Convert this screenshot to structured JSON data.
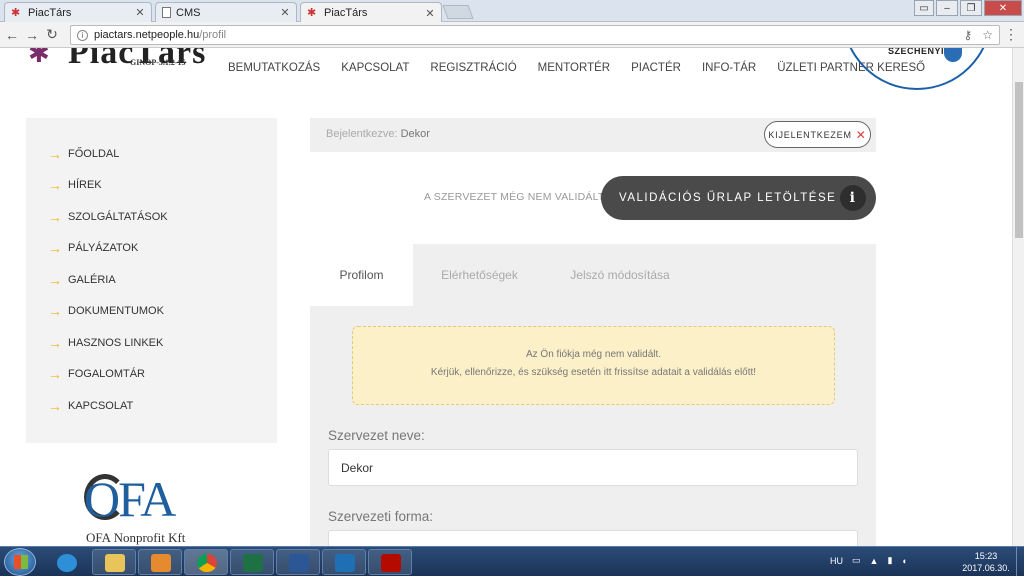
{
  "browser": {
    "tabs": [
      {
        "title": "PiacTárs",
        "icon": "piactars-favicon"
      },
      {
        "title": "CMS",
        "icon": "document-icon"
      },
      {
        "title": "PiacTárs",
        "icon": "piactars-favicon",
        "active": true
      }
    ],
    "url_domain": "piactars.netpeople.hu",
    "url_path": "/profil"
  },
  "site": {
    "logo_text": "PiacTárs",
    "logo_sub": "GINOP-5.1.2-15",
    "nav": [
      "BEMUTATKOZÁS",
      "KAPCSOLAT",
      "REGISZTRÁCIÓ",
      "MENTORTÉR",
      "PIACTÉR",
      "INFO-TÁR",
      "ÜZLETI PARTNER KERESŐ"
    ],
    "szechenyi_text": "SZÉCHENYI"
  },
  "sidebar": {
    "items": [
      "FŐOLDAL",
      "HÍREK",
      "SZOLGÁLTATÁSOK",
      "PÁLYÁZATOK",
      "GALÉRIA",
      "DOKUMENTUMOK",
      "HASZNOS LINKEK",
      "FOGALOMTÁR",
      "KAPCSOLAT"
    ],
    "ofa_logo": "OFA",
    "ofa_sub": "OFA Nonprofit Kft"
  },
  "account": {
    "logged_in_label": "Bejelentkezve:",
    "user": "Dekor",
    "logout_label": "KIJELENTKEZEM",
    "not_validated": "A SZERVEZET MÉG NEM VALIDÁLT",
    "download_label": "VALIDÁCIÓS ŰRLAP LETÖLTÉSE"
  },
  "profile": {
    "tabs": [
      "Profilom",
      "Elérhetőségek",
      "Jelszó módosítása"
    ],
    "alert_line1": "Az Ön fiókja még nem validált.",
    "alert_line2": "Kérjük, ellenőrizze, és szükség esetén itt frissítse adatait a validálás előtt!",
    "org_name_label": "Szervezet neve:",
    "org_name_value": "Dekor",
    "org_form_label": "Szervezeti forma:"
  },
  "taskbar": {
    "lang": "HU",
    "time": "15:23",
    "date": "2017.06.30."
  },
  "colors": {
    "accent_arrow": "#f0b429",
    "dark_button": "#4a4a4a",
    "alert_bg": "#fcf0c8"
  }
}
